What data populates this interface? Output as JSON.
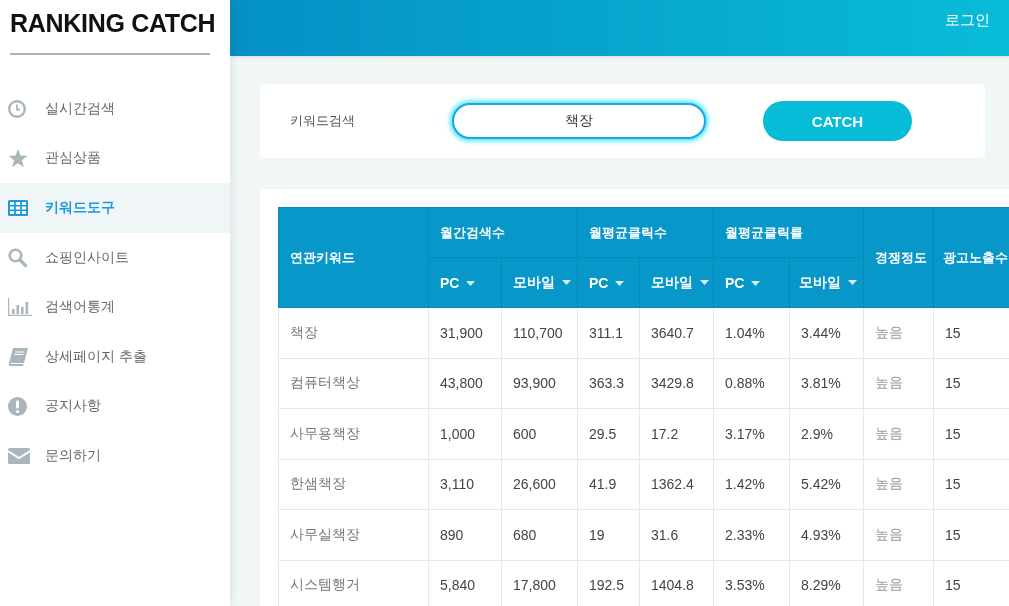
{
  "sidebar": {
    "logo": "RANKING CATCH",
    "items": [
      {
        "label": "실시간검색",
        "selected": false
      },
      {
        "label": "관심상품",
        "selected": false
      },
      {
        "label": "키워드도구",
        "selected": true
      },
      {
        "label": "쇼핑인사이트",
        "selected": false
      },
      {
        "label": "검색어통계",
        "selected": false
      },
      {
        "label": "상세페이지 추출",
        "selected": false
      },
      {
        "label": "공지사항",
        "selected": false
      },
      {
        "label": "문의하기",
        "selected": false
      }
    ]
  },
  "header": {
    "login": "로그인"
  },
  "search": {
    "label": "키워드검색",
    "value": "책장",
    "focused": true,
    "button": "CATCH"
  },
  "table": {
    "header_rows": [
      [
        {
          "label": "연관키워드",
          "rowspan": 2
        },
        {
          "label": "월간검색수",
          "colspan": 2
        },
        {
          "label": "월평균클릭수",
          "colspan": 2
        },
        {
          "label": "월평균클릭률",
          "colspan": 2
        },
        {
          "label": "경쟁정도",
          "rowspan": 2
        },
        {
          "label": "광고노출수",
          "rowspan": 2
        }
      ],
      [
        {
          "label": "PC",
          "sortable": true
        },
        {
          "label": "모바일",
          "sortable": true
        },
        {
          "label": "PC",
          "sortable": true
        },
        {
          "label": "모바일",
          "sortable": true
        },
        {
          "label": "PC",
          "sortable": true
        },
        {
          "label": "모바일",
          "sortable": true
        }
      ]
    ],
    "rows": [
      [
        "책장",
        "31,900",
        "110,700",
        "311.1",
        "3640.7",
        "1.04%",
        "3.44%",
        "높음",
        "15"
      ],
      [
        "컴퓨터책상",
        "43,800",
        "93,900",
        "363.3",
        "3429.8",
        "0.88%",
        "3.81%",
        "높음",
        "15"
      ],
      [
        "사무용책장",
        "1,000",
        "600",
        "29.5",
        "17.2",
        "3.17%",
        "2.9%",
        "높음",
        "15"
      ],
      [
        "한샘책장",
        "3,110",
        "26,600",
        "41.9",
        "1362.4",
        "1.42%",
        "5.42%",
        "높음",
        "15"
      ],
      [
        "사무실책장",
        "890",
        "680",
        "19",
        "31.6",
        "2.33%",
        "4.93%",
        "높음",
        "15"
      ],
      [
        "시스템행거",
        "5,840",
        "17,800",
        "192.5",
        "1404.8",
        "3.53%",
        "8.29%",
        "높음",
        "15"
      ]
    ]
  }
}
